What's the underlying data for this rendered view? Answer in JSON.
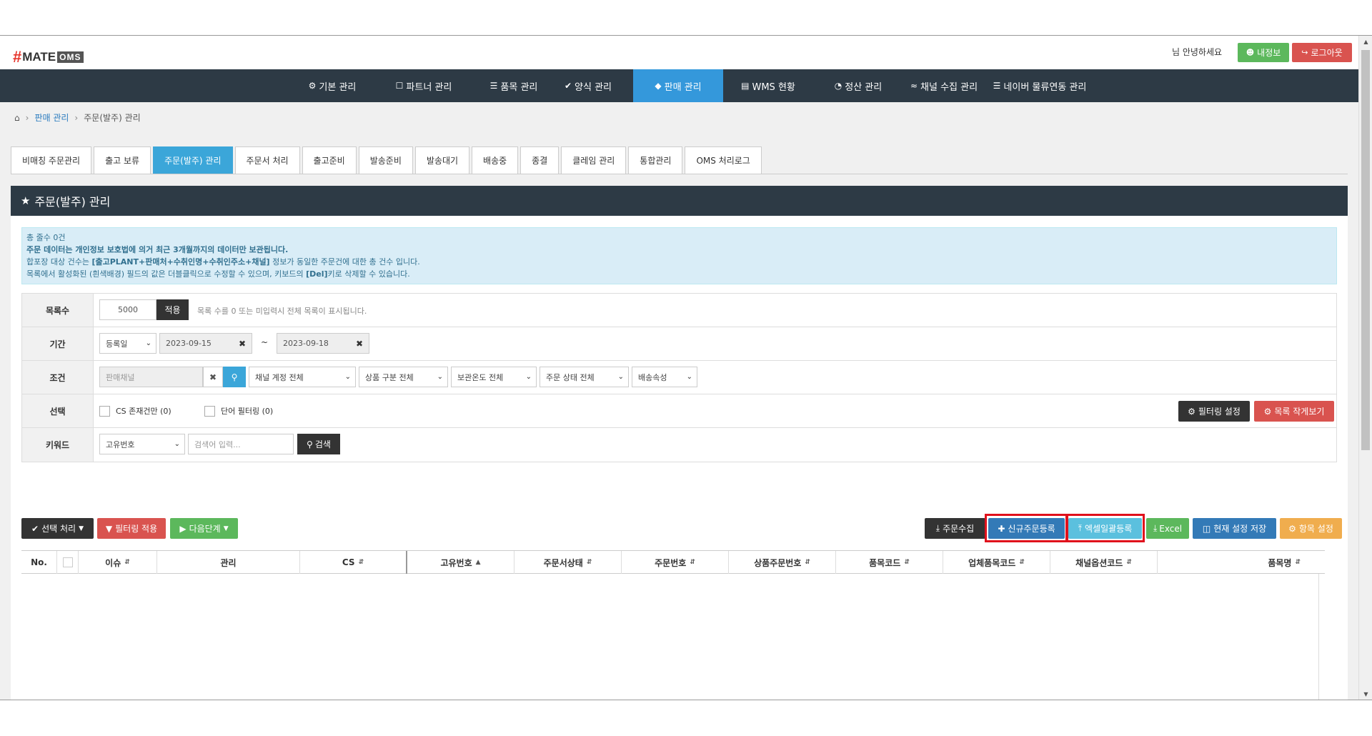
{
  "header": {
    "logo": {
      "hash": "#",
      "mate": "MATE",
      "oms": "OMS"
    },
    "greeting": "님 안녕하세요",
    "my_info": "내정보",
    "logout": "로그아웃"
  },
  "nav": [
    {
      "label": "기본 관리",
      "icon": "gear-icon"
    },
    {
      "label": "파트너 관리",
      "icon": "lock-icon"
    },
    {
      "label": "품목 관리",
      "icon": "list-icon"
    },
    {
      "label": "양식 관리",
      "icon": "check-icon"
    },
    {
      "label": "판매 관리",
      "icon": "diamond-icon",
      "active": true
    },
    {
      "label": "WMS 현황",
      "icon": "card-icon"
    },
    {
      "label": "정산 관리",
      "icon": "pie-icon"
    },
    {
      "label": "채널 수집 관리",
      "icon": "rss-icon"
    },
    {
      "label": "네이버 물류연동 관리",
      "icon": "list-icon"
    }
  ],
  "breadcrumb": {
    "home_icon": "home-icon",
    "parent": "판매 관리",
    "current": "주문(발주) 관리"
  },
  "tabs": [
    {
      "label": "비매칭 주문관리"
    },
    {
      "label": "출고 보류"
    },
    {
      "label": "주문(발주) 관리",
      "active": true
    },
    {
      "label": "주문서 처리"
    },
    {
      "label": "출고준비"
    },
    {
      "label": "발송준비"
    },
    {
      "label": "발송대기"
    },
    {
      "label": "배송중"
    },
    {
      "label": "종결"
    },
    {
      "label": "클레임 관리"
    },
    {
      "label": "통합관리"
    },
    {
      "label": "OMS 처리로그"
    }
  ],
  "panel": {
    "title": "주문(발주) 관리"
  },
  "notice": {
    "line1": "총 줄수 0건",
    "line2": "주문 데이터는 개인정보 보호법에 의거 최근 3개월까지의 데이터만 보관됩니다.",
    "line3_pre": "합포장 대상 건수는 ",
    "line3_bold": "[출고PLANT+판매처+수취인명+수취인주소+채널]",
    "line3_post": " 정보가 동일한 주문건에 대한 총 건수 입니다.",
    "line4_pre": "목록에서 활성화된 (흰색배경) 필드의 값은 더블클릭으로 수정할 수 있으며, 키보드의 ",
    "line4_bold": "[Del]",
    "line4_post": "키로 삭제할 수 있습니다."
  },
  "form": {
    "list_count": {
      "label": "목록수",
      "value": "5000",
      "apply": "적용",
      "hint": "목록 수를 0 또는 미입력시 전체 목록이 표시됩니다."
    },
    "period": {
      "label": "기간",
      "type": "등록일",
      "from": "2023-09-15",
      "tilde": "~",
      "to": "2023-09-18"
    },
    "condition": {
      "label": "조건",
      "channel_placeholder": "판매채널",
      "selects": [
        "채널 계정 전체",
        "상품 구분 전체",
        "보관온도 전체",
        "주문 상태 전체",
        "배송속성"
      ]
    },
    "select_row": {
      "label": "선택",
      "cs_only": "CS 존재건만 (0)",
      "word_filter": "단어 필터링 (0)",
      "filter_setting": "필터링 설정",
      "list_small": "목록 작게보기"
    },
    "keyword": {
      "label": "키워드",
      "field": "고유번호",
      "placeholder": "검색어 입력...",
      "search": "검색"
    }
  },
  "actions": {
    "select_process": "선택 처리",
    "filter_apply": "필터링 적용",
    "next_step": "다음단계",
    "order_collect": "주문수집",
    "new_order": "신규주문등록",
    "excel_bulk": "엑셀일괄등록",
    "excel": "Excel",
    "save_setting": "현재 설정 저장",
    "column_setting": "항목 설정"
  },
  "colors": {
    "nav_bg": "#2d3a45",
    "active_blue": "#3498db",
    "highlight_red": "#e0101c"
  },
  "grid": {
    "columns": [
      "No.",
      "",
      "이슈",
      "관리",
      "CS",
      "고유번호",
      "주문서상태",
      "주문번호",
      "상품주문번호",
      "품목코드",
      "업체품목코드",
      "채널옵션코드",
      "품목명"
    ]
  }
}
